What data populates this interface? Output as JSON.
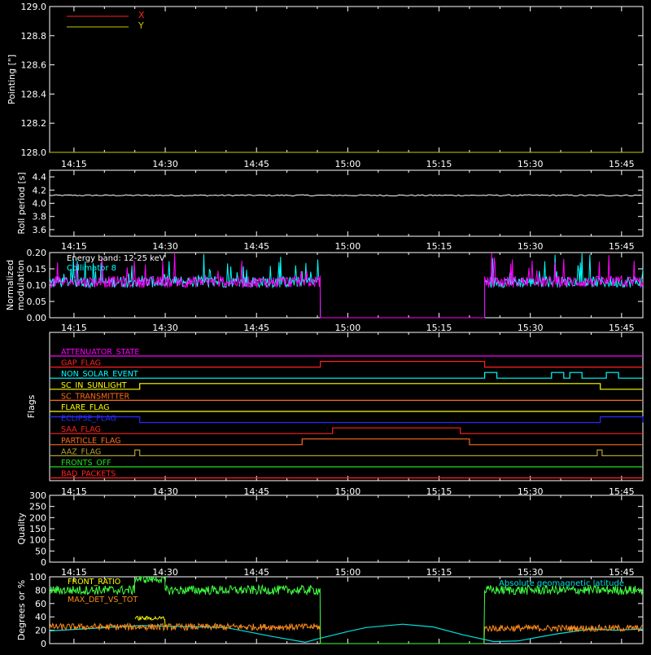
{
  "colors": {
    "axis": "#ffffff",
    "x": "#ff2020",
    "y": "#c8c800",
    "roll": "#ffffff",
    "mod_energy": "#ff00ff",
    "mod_coll": "#00ffff",
    "front_ratio": "#ffff00",
    "front_ratio_line": "#40ff40",
    "max_det": "#ff8c1a",
    "geomag": "#00e0e0",
    "quality": "#ffffff"
  },
  "time_axis": {
    "labels": [
      "14:15",
      "14:30",
      "14:45",
      "15:00",
      "15:15",
      "15:30",
      "15:45"
    ],
    "minutes": [
      15,
      30,
      45,
      60,
      75,
      90,
      105
    ],
    "range_minutes": [
      11,
      108.5
    ]
  },
  "chart_data": [
    {
      "type": "line",
      "ylabel": "Pointing [\"]",
      "ylim": [
        128.0,
        129.0
      ],
      "yticks": [
        "128.0",
        "128.2",
        "128.4",
        "128.6",
        "128.8",
        "129.0"
      ],
      "ytick_values": [
        128.0,
        128.2,
        128.4,
        128.6,
        128.8,
        129.0
      ],
      "legend": [
        {
          "name": "X",
          "color": "#ff2020"
        },
        {
          "name": "Y",
          "color": "#c8c800"
        }
      ],
      "series": [
        {
          "name": "X",
          "x": [
            11,
            108.5
          ],
          "values": [
            128.0,
            128.0
          ]
        },
        {
          "name": "Y",
          "x": [
            11,
            108.5
          ],
          "values": [
            128.0,
            128.0
          ]
        }
      ]
    },
    {
      "type": "line",
      "ylabel": "Roll period [s]",
      "ylim": [
        3.5,
        4.5
      ],
      "yticks": [
        "3.6",
        "3.8",
        "4.0",
        "4.2",
        "4.4"
      ],
      "ytick_values": [
        3.6,
        3.8,
        4.0,
        4.2,
        4.4
      ],
      "series": [
        {
          "name": "roll",
          "x": [
            11,
            108.5
          ],
          "values": [
            4.12,
            4.12
          ]
        }
      ]
    },
    {
      "type": "line",
      "ylabel_lines": [
        "Normalized",
        "modulation"
      ],
      "ylim": [
        0.0,
        0.2
      ],
      "yticks": [
        "0.00",
        "0.05",
        "0.10",
        "0.15",
        "0.20"
      ],
      "ytick_values": [
        0.0,
        0.05,
        0.1,
        0.15,
        0.2
      ],
      "annotations": [
        "Energy band: 12-25 keV",
        "Collimator 8"
      ],
      "active_intervals": [
        [
          11,
          55.5
        ],
        [
          82.5,
          108.5
        ]
      ],
      "baseline_value": 0.11,
      "off_value": 0.0
    },
    {
      "type": "line",
      "ylabel": "Flags",
      "flags": [
        {
          "name": "ATTENUATOR_STATE",
          "color": "#ff00ff",
          "high": []
        },
        {
          "name": "GAP_FLAG",
          "color": "#ff2020",
          "high": [
            [
              55.5,
              82.5
            ]
          ]
        },
        {
          "name": "NON_SOLAR_EVENT",
          "color": "#00ffff",
          "high": [
            [
              82.5,
              84.5
            ],
            [
              93.5,
              95.5
            ],
            [
              96.5,
              98.5
            ],
            [
              102.5,
              104.5
            ]
          ]
        },
        {
          "name": "SC_IN_SUNLIGHT",
          "color": "#ffff00",
          "high": [
            [
              25.8,
              101.5
            ]
          ]
        },
        {
          "name": "SC_TRANSMITTER",
          "color": "#ff6a1a",
          "high": []
        },
        {
          "name": "FLARE_FLAG",
          "color": "#ffff00",
          "high": []
        },
        {
          "name": "ECLIPSE_FLAG",
          "color": "#2a2aff",
          "high": [
            [
              11,
              25.8
            ],
            [
              101.5,
              108.5
            ]
          ]
        },
        {
          "name": "SAA_FLAG",
          "color": "#ff2020",
          "high": [
            [
              57.5,
              78.5
            ]
          ]
        },
        {
          "name": "PARTICLE_FLAG",
          "color": "#ff6a1a",
          "high": [
            [
              52.5,
              80
            ]
          ]
        },
        {
          "name": "AAZ_FLAG",
          "color": "#b0a030",
          "high": [
            [
              25,
              25.8
            ],
            [
              101,
              101.8
            ]
          ]
        },
        {
          "name": "FRONTS_OFF",
          "color": "#20e020",
          "high": []
        },
        {
          "name": "BAD_PACKETS",
          "color": "#ff2020",
          "high": []
        }
      ]
    },
    {
      "type": "line",
      "ylabel": "Quality",
      "ylim": [
        0,
        300
      ],
      "yticks": [
        "0",
        "50",
        "100",
        "150",
        "200",
        "250",
        "300"
      ],
      "ytick_values": [
        0,
        50,
        100,
        150,
        200,
        250,
        300
      ],
      "series": [
        {
          "name": "quality",
          "x": [
            11,
            108.5
          ],
          "values": [
            0,
            0
          ]
        }
      ]
    },
    {
      "type": "line",
      "ylabel": "Degrees or %",
      "ylim": [
        0,
        100
      ],
      "yticks": [
        "0",
        "20",
        "40",
        "60",
        "80",
        "100"
      ],
      "ytick_values": [
        0,
        20,
        40,
        60,
        80,
        100
      ],
      "legend": [
        {
          "name": "FRONT_RATIO",
          "color": "#ffff00"
        },
        {
          "name": "",
          "color": "#40ff40"
        },
        {
          "name": "MAX_DET_VS_TOT",
          "color": "#ff8c1a"
        }
      ],
      "right_label": "Absolute geomagnetic latitude",
      "series": [
        {
          "name": "front_ratio_line",
          "x": [
            11,
            25,
            25,
            30,
            30,
            55.5,
            55.5,
            82.5,
            82.5,
            108.5
          ],
          "values": [
            80,
            80,
            97,
            97,
            80,
            80,
            0,
            0,
            80,
            80
          ]
        },
        {
          "name": "front_ratio",
          "x": [
            25,
            25,
            30,
            30
          ],
          "values": [
            25,
            38,
            38,
            25
          ]
        },
        {
          "name": "max_det",
          "x": [
            11,
            55.5,
            55.5,
            82.5,
            82.5,
            108.5
          ],
          "values": [
            25,
            25,
            0,
            0,
            23,
            23
          ]
        },
        {
          "name": "geomag",
          "x": [
            11,
            26,
            40,
            48,
            53,
            55,
            60,
            63,
            69,
            74,
            79,
            84,
            88,
            94,
            100,
            104,
            108.5
          ],
          "values": [
            19,
            27,
            24,
            10,
            2,
            7,
            18,
            24,
            29,
            25,
            13,
            3,
            4,
            14,
            22,
            20,
            22
          ]
        }
      ]
    }
  ]
}
